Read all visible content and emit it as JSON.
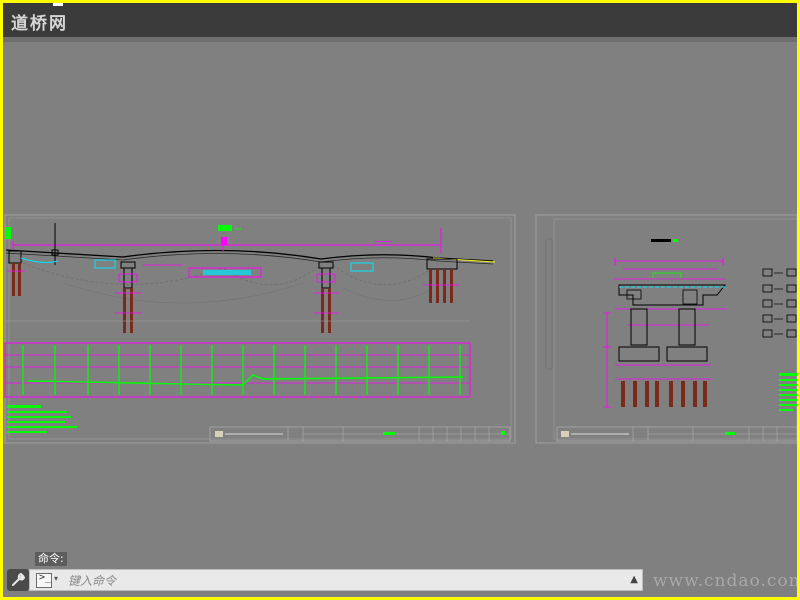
{
  "app": {
    "logo_text": "道桥网",
    "watermark_text": "www.cndao.com",
    "background_color": "#808080",
    "frame_color": "#ffff00"
  },
  "command_line": {
    "label": "命令:",
    "placeholder": "键入命令",
    "prompt_icon": "command-prompt-icon",
    "settings_icon": "wrench-icon",
    "history_icon": "caret-up-icon"
  },
  "drawing_colors": {
    "sheet_border": "#a0a0a0",
    "dimension": "#ff00ff",
    "structure": "#000000",
    "annotation": "#00ff00",
    "highlight": "#00e5ff",
    "pile": "#7a2a1a",
    "road": "#ffff00"
  }
}
